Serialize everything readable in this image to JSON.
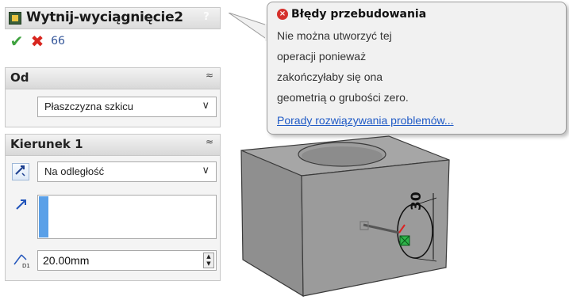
{
  "feature": {
    "title": "Wytnij-wyciągnięcie2",
    "help_glyph": "?",
    "actions": {
      "ok_glyph": "✔",
      "cancel_glyph": "✖",
      "preview_glyph": "66"
    }
  },
  "groups": {
    "od": {
      "title": "Od",
      "collapse_glyph": "≈",
      "start_condition": "Płaszczyzna szkicu"
    },
    "kierunek1": {
      "title": "Kierunek 1",
      "collapse_glyph": "≈",
      "end_condition": "Na odległość",
      "depth": "20.00mm"
    }
  },
  "error_balloon": {
    "title": "Błędy przebudowania",
    "lines": [
      "Nie można utworzyć tej",
      "operacji ponieważ",
      "zakończyłaby się ona",
      "geometrią o grubości zero."
    ],
    "link": "Porady rozwiązywania problemów..."
  },
  "model": {
    "dimension_label": "30"
  },
  "colors": {
    "ok": "#3fa23f",
    "cancel": "#d8261f",
    "error": "#d5302b",
    "link": "#1f5ac6",
    "selection": "#5aa0e8"
  }
}
